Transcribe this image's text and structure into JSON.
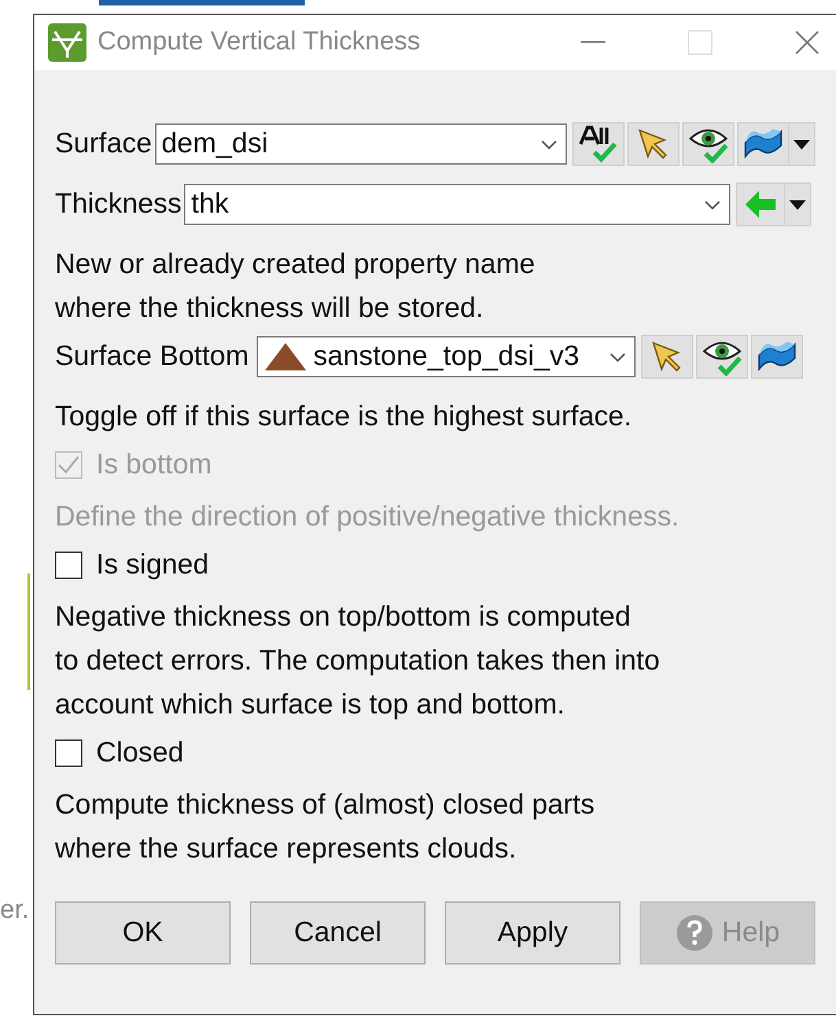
{
  "background": {
    "text_fragment": "er."
  },
  "window": {
    "title": "Compute Vertical Thickness"
  },
  "items": [
    {
      "kind": "surface_select",
      "label": "Surface",
      "value": "dem_dsi"
    },
    {
      "kind": "property_select",
      "label": "Thickness",
      "value": "thk"
    },
    {
      "kind": "note",
      "text": "New or already created property name\nwhere the thickness will be stored.",
      "disabled": false
    },
    {
      "kind": "bottom_select",
      "label": "Surface Bottom",
      "value": "sanstone_top_dsi_v3"
    },
    {
      "kind": "note",
      "text": "Toggle off if this surface is the highest surface.",
      "disabled": false
    },
    {
      "kind": "checkbox",
      "label": "Is bottom",
      "checked": true,
      "disabled": true
    },
    {
      "kind": "note",
      "text": "Define the direction of positive/negative thickness.",
      "disabled": true
    },
    {
      "kind": "checkbox",
      "label": "Is signed",
      "checked": false,
      "disabled": false
    },
    {
      "kind": "note",
      "text": "Negative thickness on top/bottom is computed\nto detect errors. The computation takes then into\naccount which surface is top and bottom.",
      "disabled": false
    },
    {
      "kind": "checkbox",
      "label": "Closed",
      "checked": false,
      "disabled": false
    },
    {
      "kind": "note",
      "text": "Compute thickness of (almost) closed parts\nwhere the surface represents clouds.",
      "disabled": false
    }
  ],
  "buttons": [
    {
      "kind": "text",
      "label": "OK",
      "disabled": false
    },
    {
      "kind": "text",
      "label": "Cancel",
      "disabled": false
    },
    {
      "kind": "text",
      "label": "Apply",
      "disabled": false
    },
    {
      "kind": "help",
      "label": "Help",
      "disabled": true
    }
  ]
}
